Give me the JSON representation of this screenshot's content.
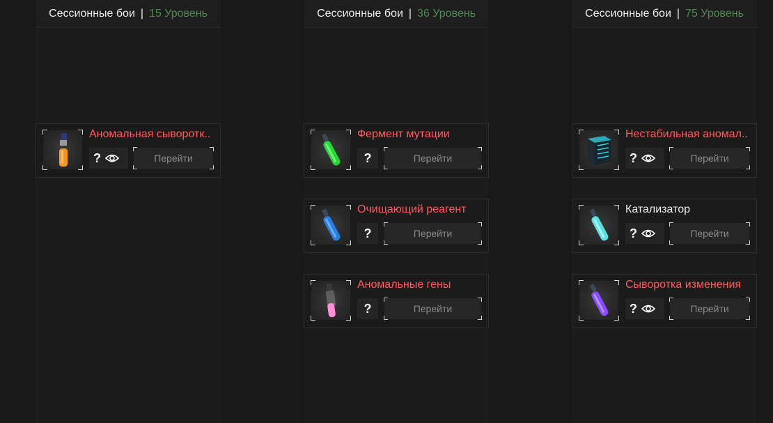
{
  "columns": [
    {
      "header": {
        "mode": "Сессионные бои",
        "separator": "|",
        "level": "15 Уровень"
      },
      "items": [
        {
          "name": "Аномальная сывороткa..",
          "name_display": "Аномальная сыворотк..",
          "go": "Перейти",
          "question": "?",
          "has_eye": true,
          "icon": "orange-vial-icon",
          "name_color": "#ff5a5f"
        }
      ]
    },
    {
      "header": {
        "mode": "Сессионные бои",
        "separator": "|",
        "level": "36 Уровень"
      },
      "items": [
        {
          "name_display": "Фермент мутации",
          "go": "Перейти",
          "question": "?",
          "has_eye": false,
          "icon": "green-vial-icon",
          "name_color": "#ff5a5f"
        },
        {
          "name_display": "Очищающий реагент",
          "go": "Перейти",
          "question": "?",
          "has_eye": false,
          "icon": "blue-vial-icon",
          "name_color": "#ff5a5f"
        },
        {
          "name_display": "Аномальные гены",
          "go": "Перейти",
          "question": "?",
          "has_eye": false,
          "icon": "pink-vial-icon",
          "name_color": "#ff5a5f"
        }
      ]
    },
    {
      "header": {
        "mode": "Сессионные бои",
        "separator": "|",
        "level": "75 Уровень"
      },
      "items": [
        {
          "name_display": "Нестабильная аномал..",
          "go": "Перейти",
          "question": "?",
          "has_eye": true,
          "icon": "device-block-icon",
          "name_color": "#ff5a5f"
        },
        {
          "name_display": "Катализатор",
          "go": "Перейти",
          "question": "?",
          "has_eye": true,
          "icon": "cyan-vial-icon",
          "name_color": "#eeeeee"
        },
        {
          "name_display": "Сыворотка изменения",
          "go": "Перейти",
          "question": "?",
          "has_eye": true,
          "icon": "purple-vial-icon",
          "name_color": "#ff5a5f"
        }
      ]
    }
  ],
  "colors": {
    "background": "#191919",
    "item_name_red": "#ff5a5f",
    "level_green": "#4e8a52"
  }
}
